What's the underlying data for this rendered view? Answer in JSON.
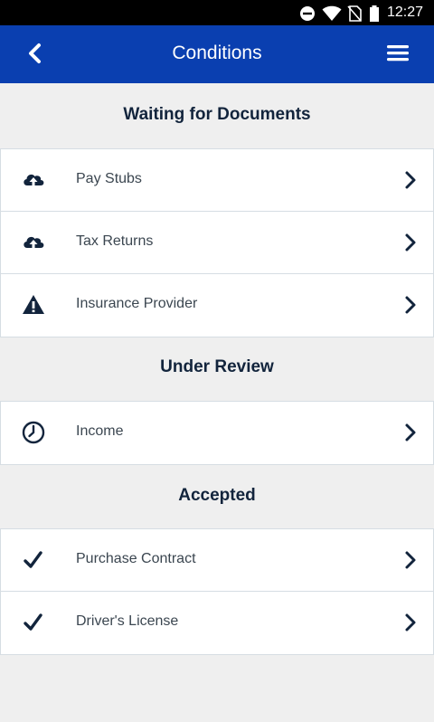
{
  "status_bar": {
    "time": "12:27",
    "icons": [
      "do-not-disturb-icon",
      "wifi-icon",
      "no-sim-icon",
      "battery-icon"
    ]
  },
  "app_bar": {
    "title": "Conditions",
    "back_icon": "chevron-left-icon",
    "menu_icon": "hamburger-menu-icon",
    "background": "#0a3fb0"
  },
  "sections": [
    {
      "title": "Waiting for Documents",
      "items": [
        {
          "label": "Pay Stubs",
          "icon": "cloud-upload-icon"
        },
        {
          "label": "Tax Returns",
          "icon": "cloud-upload-icon"
        },
        {
          "label": "Insurance Provider",
          "icon": "warning-icon"
        }
      ]
    },
    {
      "title": "Under Review",
      "items": [
        {
          "label": "Income",
          "icon": "clock-icon"
        }
      ]
    },
    {
      "title": "Accepted",
      "items": [
        {
          "label": "Purchase Contract",
          "icon": "check-icon"
        },
        {
          "label": "Driver's License",
          "icon": "check-icon"
        }
      ]
    }
  ],
  "colors": {
    "text_dark": "#12243c",
    "label": "#3b4650",
    "divider": "#d6dde3",
    "page_bg": "#efefef"
  }
}
